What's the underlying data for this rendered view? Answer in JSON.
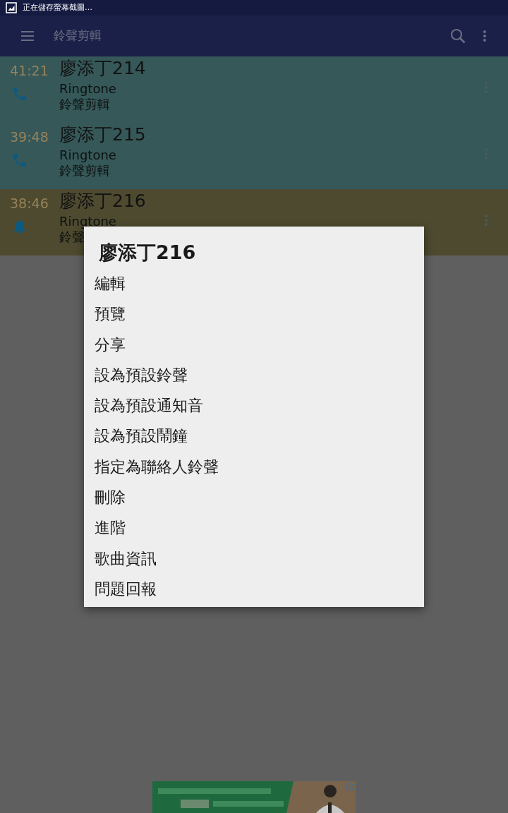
{
  "status_bar": {
    "notification": "正在儲存螢幕截圖…"
  },
  "app_bar": {
    "title": "鈴聲剪輯"
  },
  "list": [
    {
      "time": "41:21",
      "title": "廖添丁214",
      "kind": "ringtone",
      "type": "Ringtone",
      "artist": "鈴聲剪輯",
      "selected": false
    },
    {
      "time": "39:48",
      "title": "廖添丁215",
      "kind": "ringtone",
      "type": "Ringtone",
      "artist": "鈴聲剪輯",
      "selected": false
    },
    {
      "time": "38:46",
      "title": "廖添丁216",
      "kind": "alarm",
      "type": "Ringtone",
      "artist": "鈴聲",
      "selected": true
    }
  ],
  "menu": {
    "title": "廖添丁216",
    "items": [
      "編輯",
      "預覽",
      "分享",
      "設為預設鈴聲",
      "設為預設通知音",
      "設為預設鬧鐘",
      "指定為聯絡人鈴聲",
      "刪除",
      "進階",
      "歌曲資訊",
      "問題回報"
    ]
  }
}
